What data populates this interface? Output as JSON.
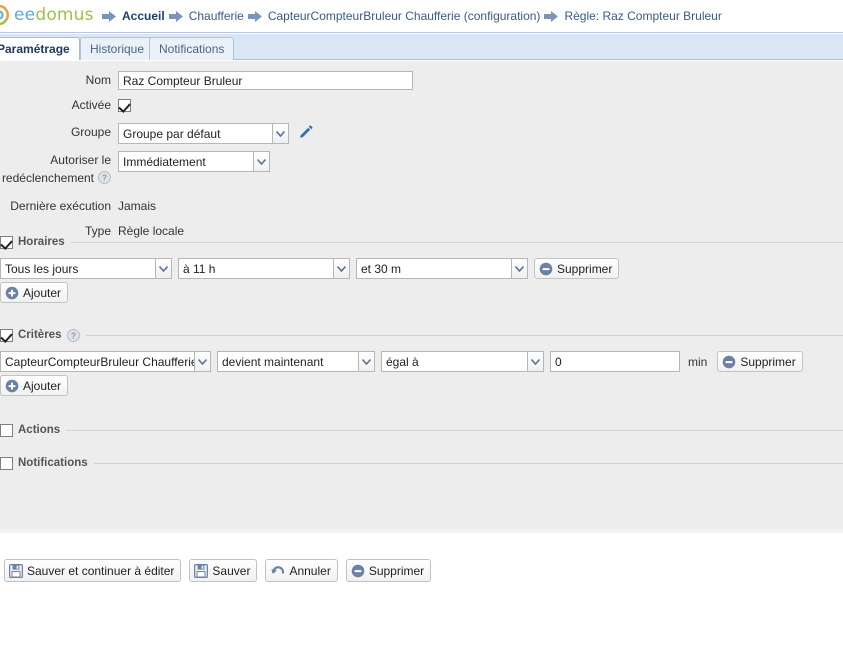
{
  "app": {
    "logo_text_part1": "ee",
    "logo_text_part2": "domus",
    "logo_icon": "eedomus-ring-logo"
  },
  "breadcrumb": {
    "items": [
      {
        "label": "Accueil",
        "icon": "arrow-right-icon"
      },
      {
        "label": "Chaufferie",
        "icon": "arrow-right-icon"
      },
      {
        "label": "CapteurCompteurBruleur Chaufferie (configuration)",
        "icon": "arrow-right-icon"
      },
      {
        "label": "Règle: Raz Compteur Bruleur",
        "icon": "arrow-right-icon"
      }
    ]
  },
  "tabs": [
    {
      "label": "Paramétrage",
      "active": true
    },
    {
      "label": "Historique",
      "active": false
    },
    {
      "label": "Notifications",
      "active": false
    }
  ],
  "form": {
    "nom": {
      "label": "Nom",
      "value": "Raz Compteur Bruleur"
    },
    "activee": {
      "label": "Activée",
      "checked": true
    },
    "groupe": {
      "label": "Groupe",
      "value": "Groupe par défaut",
      "edit_icon": "pencil-icon"
    },
    "redeclenchement": {
      "label_line1": "Autoriser le",
      "label_line2": "redéclenchement",
      "value": "Immédiatement",
      "help_icon": "help-question-icon"
    },
    "derniere_execution": {
      "label": "Dernière exécution",
      "value": "Jamais"
    },
    "type": {
      "label": "Type",
      "value": "Règle locale"
    }
  },
  "sections": {
    "horaires": {
      "title": "Horaires",
      "checked": true,
      "rows": [
        {
          "jours": "Tous les jours",
          "heure": "à 11 h",
          "minute": "et 30 m",
          "delete_label": "Supprimer",
          "delete_icon": "minus-circle-icon"
        }
      ],
      "add_label": "Ajouter",
      "add_icon": "plus-circle-icon"
    },
    "criteres": {
      "title": "Critères",
      "checked": true,
      "help_icon": "help-question-icon",
      "rows": [
        {
          "capteur": "CapteurCompteurBruleur Chaufferie",
          "evenement": "devient maintenant",
          "operateur": "égal à",
          "valeur": "0",
          "unite": "min",
          "delete_label": "Supprimer",
          "delete_icon": "minus-circle-icon"
        }
      ],
      "add_label": "Ajouter",
      "add_icon": "plus-circle-icon"
    },
    "actions": {
      "title": "Actions",
      "checked": false
    },
    "notifications": {
      "title": "Notifications",
      "checked": false
    }
  },
  "footer_buttons": [
    {
      "label": "Sauver et continuer à éditer",
      "icon": "floppy-save-icon"
    },
    {
      "label": "Sauver",
      "icon": "floppy-save-icon"
    },
    {
      "label": "Annuler",
      "icon": "undo-arrow-icon"
    },
    {
      "label": "Supprimer",
      "icon": "minus-circle-icon"
    }
  ],
  "colors": {
    "header_border": "#b9c6de",
    "tabstrip_bg": "#dbe6f4",
    "panel_bg": "#ededed",
    "breadcrumb_text": "#3a5a86",
    "logo_green": "#9ac43c",
    "logo_blue": "#5fa9d8",
    "icon_blue_gray": "#6b82a6",
    "pencil_blue": "#2f72b8"
  }
}
